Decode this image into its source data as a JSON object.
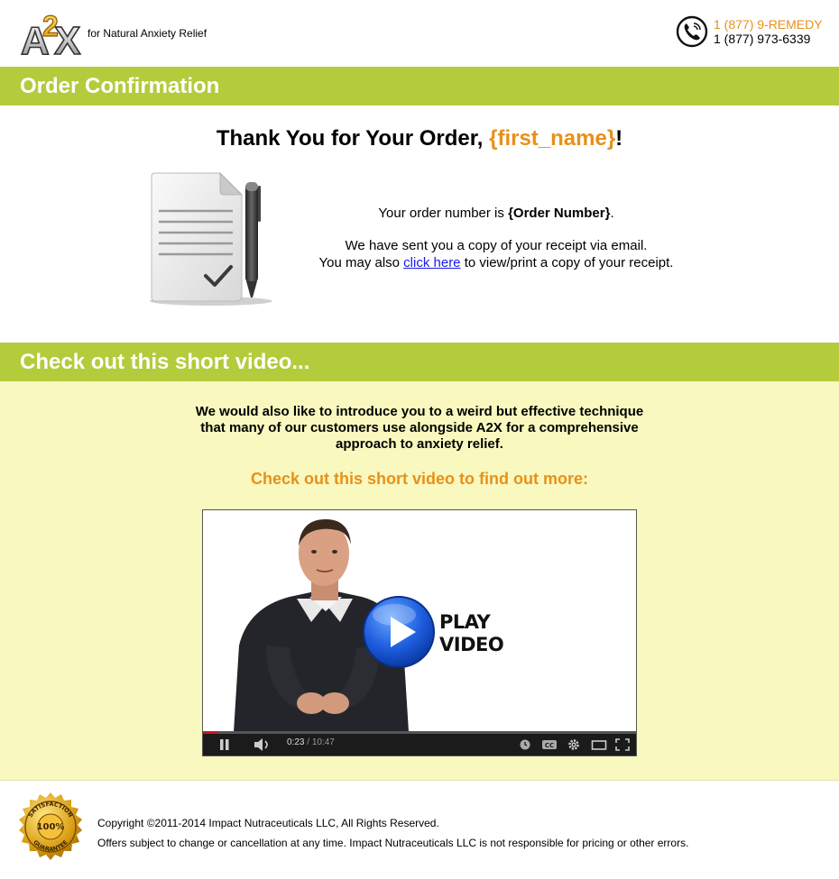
{
  "header": {
    "brand": "A2X",
    "tagline": "for Natural Anxiety Relief",
    "phone_vanity": "1 (877) 9-REMEDY",
    "phone_number": "1 (877) 973-6339"
  },
  "confirmation": {
    "bar_title": "Order Confirmation",
    "thanks_prefix": "Thank You for Your Order, ",
    "first_name_token": "{first_name}",
    "thanks_suffix": "!",
    "order_prefix": "Your order number is ",
    "order_token": "{Order Number}",
    "order_suffix": ".",
    "receipt_line": "We have sent you a copy of your receipt via email.",
    "view_prefix": "You may also ",
    "view_link": "click here",
    "view_suffix": " to view/print a copy of your receipt."
  },
  "video_section": {
    "bar_title": "Check out this short video...",
    "intro_line1": "We would also like to introduce you to a weird but effective technique",
    "intro_line2": "that many of our customers use alongside A2X for a comprehensive",
    "intro_line3": "approach to anxiety relief.",
    "cta": "Check out this short video to find out more:",
    "play_line1": "PLAY",
    "play_line2": "VIDEO",
    "current_time": "0:23",
    "separator": " / ",
    "duration": "10:47",
    "progress_fraction": 0.036
  },
  "footer": {
    "seal_top": "SATISFACTION",
    "seal_center": "100%",
    "seal_bottom": "GUARANTEE",
    "copyright": "Copyright ©2011-2014 Impact Nutraceuticals LLC, All Rights Reserved.",
    "disclaimer": "Offers subject to change or cancellation at any time. Impact Nutraceuticals LLC is not responsible for pricing or other errors."
  },
  "colors": {
    "green_bar": "#b4cb3c",
    "accent_orange": "#e8901a",
    "video_bg": "#f8f8bf",
    "link_blue": "#1a1ae6"
  },
  "icons": [
    "phone-icon",
    "document-icon",
    "pen-icon",
    "play-icon",
    "pause-icon",
    "volume-icon",
    "clock-icon",
    "cc-icon",
    "gear-icon",
    "theater-icon",
    "fullscreen-icon"
  ]
}
